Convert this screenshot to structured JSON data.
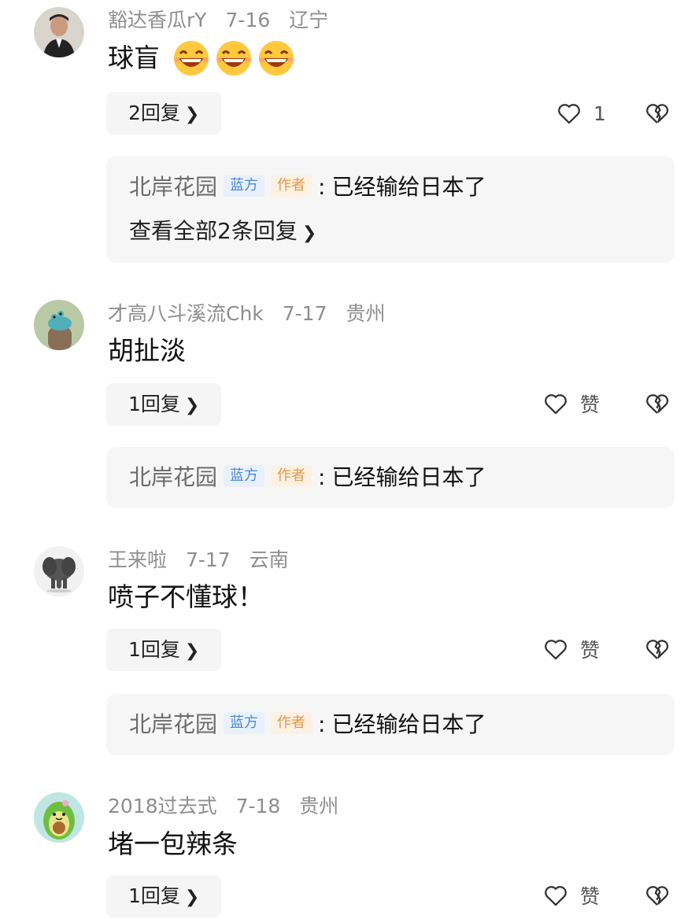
{
  "comments": [
    {
      "user": "豁达香瓜rY",
      "date": "7-16",
      "location": "辽宁",
      "text": "球盲",
      "emoji_count": 3,
      "reply_label": "2回复",
      "like_label": "1",
      "reply": {
        "author": "北岸花园",
        "tag_blue": "蓝方",
        "tag_orange": "作者",
        "colon": ":",
        "content": "已经输给日本了",
        "view_all": "查看全部2条回复"
      }
    },
    {
      "user": "才高八斗溪流Chk",
      "date": "7-17",
      "location": "贵州",
      "text": "胡扯淡",
      "reply_label": "1回复",
      "like_label": "赞",
      "reply": {
        "author": "北岸花园",
        "tag_blue": "蓝方",
        "tag_orange": "作者",
        "colon": ":",
        "content": "已经输给日本了"
      }
    },
    {
      "user": "王来啦",
      "date": "7-17",
      "location": "云南",
      "text": "喷子不懂球！",
      "reply_label": "1回复",
      "like_label": "赞",
      "reply": {
        "author": "北岸花园",
        "tag_blue": "蓝方",
        "tag_orange": "作者",
        "colon": ":",
        "content": "已经输给日本了"
      }
    },
    {
      "user": "2018过去式",
      "date": "7-18",
      "location": "贵州",
      "text": "堵一包辣条",
      "reply_label": "1回复",
      "like_label": "赞"
    }
  ],
  "icons": {
    "reply_chevron": "chevron-right-icon",
    "like": "heart-outline-icon",
    "dislike": "broken-heart-icon",
    "emoji": "laughing-emoji-icon"
  },
  "colors": {
    "meta_gray": "#8e8e8e",
    "tag_blue": "#4a88d8",
    "tag_orange": "#e19a4c",
    "bubble_bg": "#f6f6f6"
  }
}
